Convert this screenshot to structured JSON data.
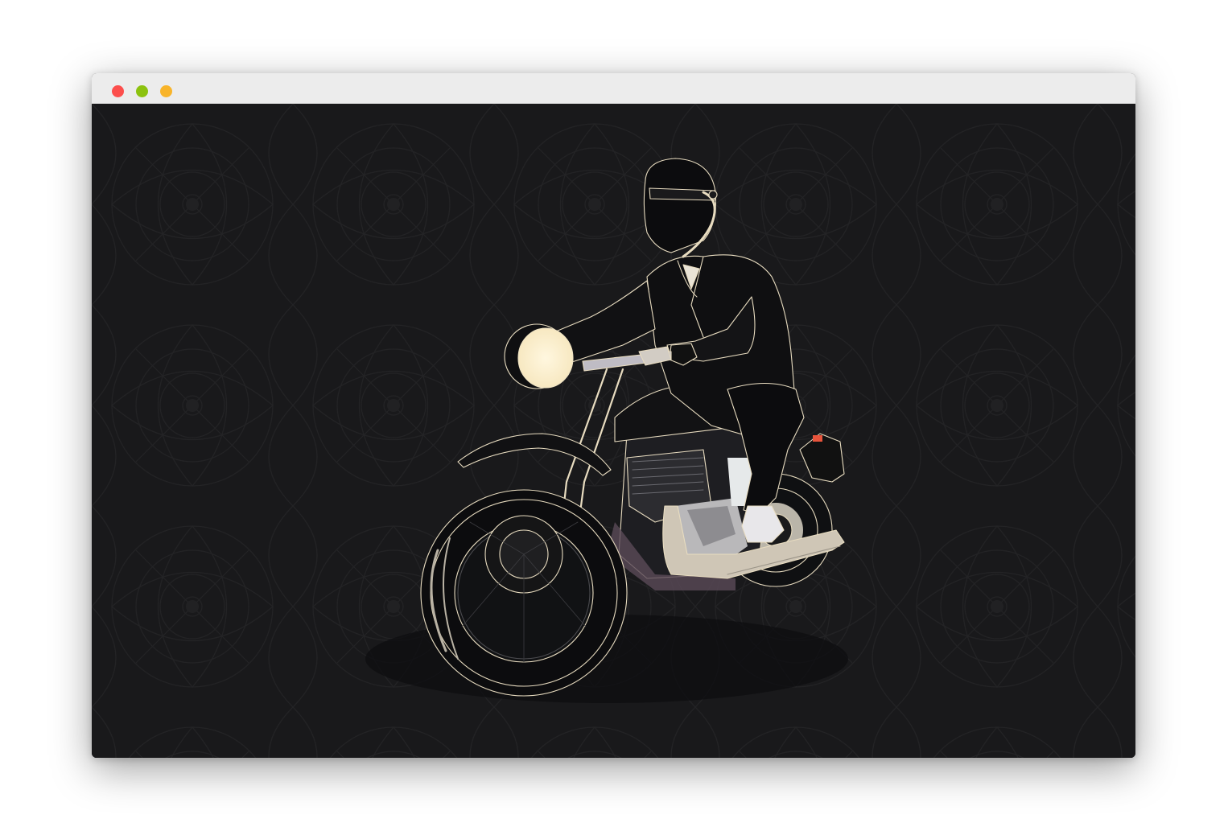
{
  "window": {
    "controls": [
      {
        "name": "close",
        "color": "#fc4e4c"
      },
      {
        "name": "minimize",
        "color": "#8cc20f"
      },
      {
        "name": "maximize",
        "color": "#f8b42a"
      }
    ]
  },
  "canvas": {
    "background": "#19191b",
    "pattern_color": "#242426",
    "line_color": "#e8dcc0",
    "headlight_color": "#fdf0d0",
    "taillight_color": "#e8543c"
  },
  "illustration": {
    "subject": "motorcycle-rider-illustration",
    "icon": "motorcycle-icon"
  }
}
